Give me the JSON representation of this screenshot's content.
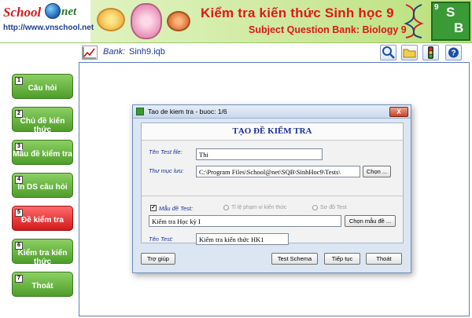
{
  "header": {
    "logo_school": "School",
    "logo_net": "net",
    "logo_url": "http://www.vnschool.net",
    "title": "Kiểm tra kiến thức Sinh học 9",
    "subtitle": "Subject Question Bank: Biology 9",
    "sb_number": "9",
    "sb_s": "S",
    "sb_b": "B"
  },
  "toolbar": {
    "bank_label": "Bank:",
    "bank_value": "Sinh9.iqb",
    "buttons": [
      "search-icon",
      "folder-icon",
      "traffic-light-icon",
      "help-icon"
    ]
  },
  "sidebar": {
    "items": [
      {
        "num": "1",
        "label": "Câu hỏi"
      },
      {
        "num": "2",
        "label": "Chủ đề kiến thức"
      },
      {
        "num": "3",
        "label": "Mẫu đề kiểm tra"
      },
      {
        "num": "4",
        "label": "In DS câu hỏi"
      },
      {
        "num": "5",
        "label": "Đề kiểm tra",
        "active": true
      },
      {
        "num": "6",
        "label": "Kiểm tra kiến thức"
      },
      {
        "num": "7",
        "label": "Thoát"
      }
    ]
  },
  "dialog": {
    "title": "Tao de kiem tra - buoc: 1/6",
    "close": "X",
    "heading": "TẠO ĐỀ KIỂM TRA",
    "test_file_label": "Tên Test file:",
    "test_file_value": "Thi",
    "folder_label": "Thư mục lưu:",
    "folder_value": "C:\\Program Files\\School@net\\SQB\\SinhHoc9\\Tests\\",
    "choose_button": "Chọn ...",
    "template_check_label": "Mẫu đề Test:",
    "radio1": "Tỉ lệ phạm vi kiến thức",
    "radio2": "Sơ đồ Test",
    "template_value": "Kiểm tra Học kỳ I",
    "choose_template_button": "Chọn mẫu đề ...",
    "test_name_label": "Tên Test:",
    "test_name_value": "Kiểm tra kiến thức HK1",
    "help_button": "Trợ giúp",
    "schema_button": "Test Schema",
    "next_button": "Tiếp tục",
    "exit_button": "Thoát"
  }
}
